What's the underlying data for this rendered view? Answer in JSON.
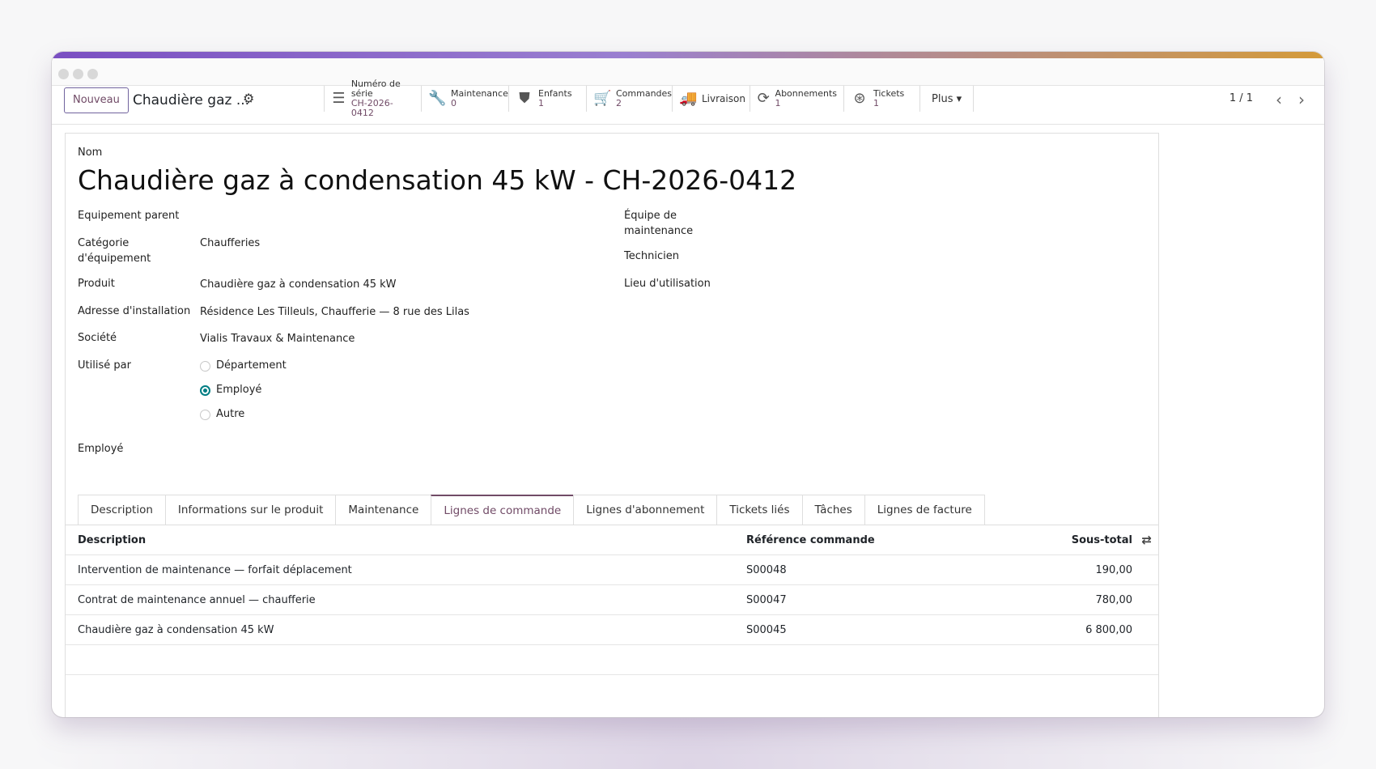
{
  "colors": {
    "brand": "#714b67",
    "accent_teal": "#017e84",
    "bar_start": "#7a4fc2",
    "bar_end": "#d49b3a"
  },
  "control_panel": {
    "new_button": "Nouveau",
    "breadcrumb": "Chaudière gaz ...",
    "gear_icon": "⚙",
    "pager": "1 / 1",
    "prev_icon": "‹",
    "next_icon": "›"
  },
  "smart_buttons": [
    {
      "icon": "list-icon",
      "glyph": "☰",
      "label": "Numéro de série",
      "value": "CH-2026-0412"
    },
    {
      "icon": "wrench-icon",
      "glyph": "🔧",
      "label": "Maintenance",
      "value": "0"
    },
    {
      "icon": "sitemap-icon",
      "glyph": "⛊",
      "label": "Enfants",
      "value": "1"
    },
    {
      "icon": "cart-icon",
      "glyph": "🛒",
      "label": "Commandes",
      "value": "2"
    },
    {
      "icon": "truck-icon",
      "glyph": "🚚",
      "label": "Livraison"
    },
    {
      "icon": "refresh-icon",
      "glyph": "⟳",
      "label": "Abonnements",
      "value": "1"
    },
    {
      "icon": "lifebuoy-icon",
      "glyph": "⊛",
      "label": "Tickets",
      "value": "1"
    }
  ],
  "more_button": "Plus ▾",
  "form": {
    "name_label": "Nom",
    "name_value": "Chaudière gaz à condensation 45 kW - CH-2026-0412",
    "parent_label": "Equipement parent",
    "category_label": "Catégorie d'équipement",
    "category_value": "Chaufferies",
    "product_label": "Produit",
    "product_value": "Chaudière gaz à condensation 45 kW",
    "install_label": "Adresse d'installation",
    "install_value": "Résidence Les Tilleuls, Chaufferie — 8 rue des Lilas",
    "company_label": "Société",
    "company_value": "Vialis Travaux & Maintenance",
    "used_by_label": "Utilisé par",
    "used_by_options": [
      "Département",
      "Employé",
      "Autre"
    ],
    "used_by_selected": "Employé",
    "employee_label": "Employé",
    "team_label": "Équipe de maintenance",
    "technician_label": "Technicien",
    "location_label": "Lieu d'utilisation"
  },
  "tabs": [
    {
      "label": "Description",
      "active": false
    },
    {
      "label": "Informations sur le produit",
      "active": false
    },
    {
      "label": "Maintenance",
      "active": false
    },
    {
      "label": "Lignes de commande",
      "active": true
    },
    {
      "label": "Lignes d'abonnement",
      "active": false
    },
    {
      "label": "Tickets liés",
      "active": false
    },
    {
      "label": "Tâches",
      "active": false
    },
    {
      "label": "Lignes de facture",
      "active": false
    }
  ],
  "order_lines": {
    "headers": {
      "description": "Description",
      "reference": "Référence commande",
      "subtotal": "Sous-total"
    },
    "rows": [
      {
        "description": "Intervention de maintenance — forfait déplacement",
        "reference": "S00048",
        "subtotal": "190,00"
      },
      {
        "description": "Contrat de maintenance annuel — chaufferie",
        "reference": "S00047",
        "subtotal": "780,00"
      },
      {
        "description": "Chaudière gaz à condensation 45 kW",
        "reference": "S00045",
        "subtotal": "6 800,00"
      }
    ]
  }
}
